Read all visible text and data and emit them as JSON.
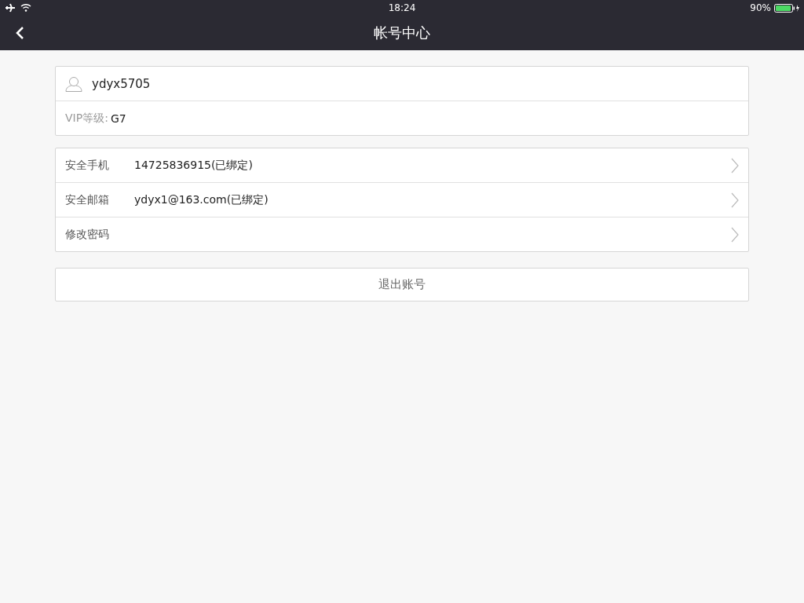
{
  "status_bar": {
    "time": "18:24",
    "battery": "90%"
  },
  "nav_bar": {
    "title": "帐号中心"
  },
  "profile": {
    "username": "ydyx5705",
    "vip_label": "VIP等级:",
    "vip_value": "G7"
  },
  "security_items": [
    {
      "label": "安全手机",
      "value": "14725836915(已绑定)"
    },
    {
      "label": "安全邮箱",
      "value": "ydyx1@163.com(已绑定)"
    },
    {
      "label": "修改密码"
    }
  ],
  "logout_button": "退出账号"
}
